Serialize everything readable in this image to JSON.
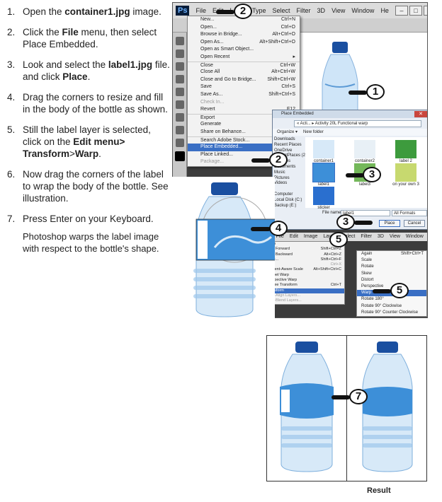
{
  "steps": [
    {
      "num": "1.",
      "parts": [
        "Open the ",
        "container1.jpg",
        " image."
      ]
    },
    {
      "num": "2.",
      "parts": [
        "Click the ",
        "File",
        " menu, then select Place Embedded."
      ]
    },
    {
      "num": "3.",
      "parts": [
        "Look and select the ",
        "label1.jpg",
        " file. and click ",
        "Place",
        "."
      ]
    },
    {
      "num": "4.",
      "text": "Drag the corners to resize and fill in the body of the bottle as shown."
    },
    {
      "num": "5.",
      "parts": [
        "Still the label layer is selected, click on the ",
        "Edit menu> Transform",
        ">",
        "Warp",
        "."
      ]
    },
    {
      "num": "6.",
      "text": "Now drag the corners of the label to wrap the body of the bottle. See illustration."
    },
    {
      "num": "7.",
      "text": "Press Enter on your Keyboard."
    }
  ],
  "note": "Photoshop warps the label image with respect to the bottle's shape.",
  "ps": {
    "logo": "Ps",
    "menubar": [
      "File",
      "Edit",
      "Layer",
      "Type",
      "Select",
      "Filter",
      "3D",
      "View",
      "Window",
      "He"
    ]
  },
  "file_menu": [
    {
      "label": "New...",
      "shortcut": "Ctrl+N"
    },
    {
      "label": "Open...",
      "shortcut": "Ctrl+O"
    },
    {
      "label": "Browse in Bridge...",
      "shortcut": "Alt+Ctrl+O"
    },
    {
      "label": "Open As...",
      "shortcut": "Alt+Shift+Ctrl+O"
    },
    {
      "label": "Open as Smart Object...",
      "shortcut": ""
    },
    {
      "label": "Open Recent",
      "shortcut": "▸"
    },
    {
      "label": "Close",
      "shortcut": "Ctrl+W",
      "sep": true
    },
    {
      "label": "Close All",
      "shortcut": "Alt+Ctrl+W"
    },
    {
      "label": "Close and Go to Bridge...",
      "shortcut": "Shift+Ctrl+W"
    },
    {
      "label": "Save",
      "shortcut": "Ctrl+S"
    },
    {
      "label": "Save As...",
      "shortcut": "Shift+Ctrl+S"
    },
    {
      "label": "Check In...",
      "shortcut": "",
      "disabled": true
    },
    {
      "label": "Revert",
      "shortcut": "F12"
    },
    {
      "label": "Export",
      "shortcut": "",
      "sep": true
    },
    {
      "label": "Generate",
      "shortcut": ""
    },
    {
      "label": "Share on Behance...",
      "shortcut": ""
    },
    {
      "label": "Search Adobe Stock...",
      "shortcut": "",
      "sep": true
    },
    {
      "label": "Place Embedded...",
      "shortcut": "",
      "highlight": true
    },
    {
      "label": "Place Linked...",
      "shortcut": ""
    },
    {
      "label": "Package...",
      "shortcut": "",
      "disabled": true
    }
  ],
  "place_dialog": {
    "title": "Place Embedded",
    "address": "« Acti... ▸ Activity 20L Functional warp",
    "organize": "Organize ▾",
    "new_folder": "New folder",
    "nav": [
      "Downloads",
      "Recent Places",
      "OneDrive",
      "RecentPlaces (2)",
      "Libraries",
      "Documents",
      "Music",
      "Pictures",
      "Videos",
      "",
      "Computer",
      "Local Disk (C:)",
      "Backup (E:)"
    ],
    "files": [
      "container1",
      "container2",
      "label 2",
      "label1",
      "label3",
      "on your own 3",
      "sticker"
    ],
    "filename_label": "File name:",
    "filename": "label1",
    "filetype": "All Formats",
    "place_btn": "Place",
    "cancel_btn": "Cancel"
  },
  "edit_bar": [
    "Ps",
    "File",
    "Edit",
    "Image",
    "Layer",
    "Select",
    "Filter",
    "3D",
    "View",
    "Window"
  ],
  "edit_menu": [
    {
      "label": "Undo",
      "shortcut": "Ctrl+Z"
    },
    {
      "label": "Step Forward",
      "shortcut": "Shift+Ctrl+Z"
    },
    {
      "label": "Step Backward",
      "shortcut": "Alt+Ctrl+Z"
    },
    {
      "label": "Fade...",
      "shortcut": "Shift+Ctrl+F"
    },
    {
      "label": "Cut",
      "shortcut": "Ctrl+X",
      "disabled": true
    },
    {
      "label": "Content-Aware Scale",
      "shortcut": "Alt+Shift+Ctrl+C"
    },
    {
      "label": "Puppet Warp",
      "shortcut": ""
    },
    {
      "label": "Perspective Warp",
      "shortcut": ""
    },
    {
      "label": "✔ Free Transform",
      "shortcut": "Ctrl+T"
    },
    {
      "label": "Transform",
      "shortcut": "",
      "highlight": true
    },
    {
      "label": "Auto-Align Layers...",
      "shortcut": "",
      "disabled": true
    },
    {
      "label": "Auto-Blend Layers...",
      "shortcut": "",
      "disabled": true
    }
  ],
  "transform_menu": [
    {
      "label": "Again",
      "shortcut": "Shift+Ctrl+T"
    },
    {
      "label": "Scale"
    },
    {
      "label": "Rotate"
    },
    {
      "label": "Skew"
    },
    {
      "label": "Distort"
    },
    {
      "label": "Perspective"
    },
    {
      "label": "Warp",
      "highlight": true
    },
    {
      "label": "Rotate 180°"
    },
    {
      "label": "Rotate 90° Clockwise"
    },
    {
      "label": "Rotate 90° Counter Clockwise"
    }
  ],
  "callouts": [
    "2",
    "1",
    "2",
    "3",
    "3",
    "4",
    "5",
    "5",
    "7"
  ],
  "result_label": "Result",
  "colors": {
    "accent": "#3a6fc4",
    "bottle_blue": "#1f63b8"
  }
}
